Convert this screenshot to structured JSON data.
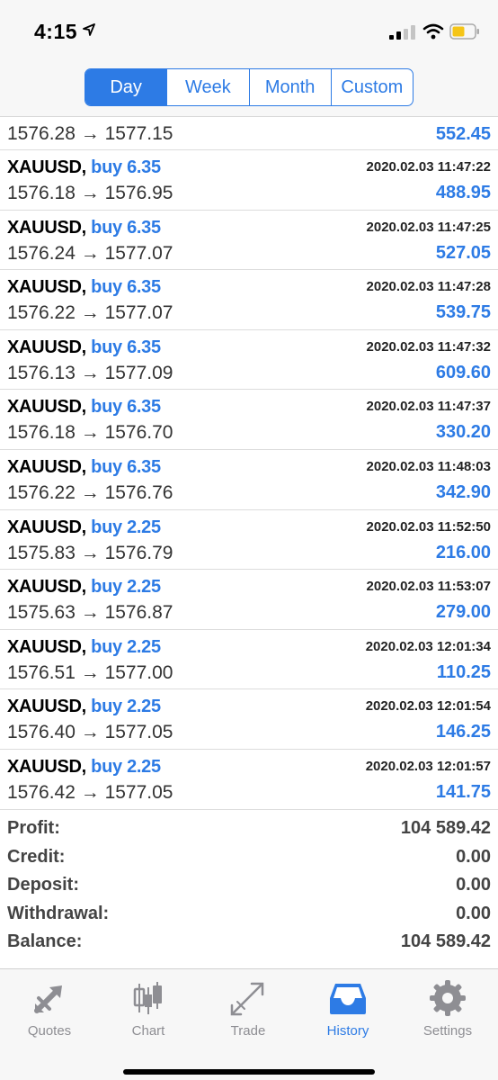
{
  "status": {
    "time": "4:15"
  },
  "periods": [
    {
      "label": "Day",
      "active": true
    },
    {
      "label": "Week",
      "active": false
    },
    {
      "label": "Month",
      "active": false
    },
    {
      "label": "Custom",
      "active": false
    }
  ],
  "partial_deal": {
    "prices": "1576.28 → 1577.15",
    "profit": "552.45"
  },
  "deals": [
    {
      "symbol": "XAUUSD",
      "side": "buy 6.35",
      "time": "2020.02.03 11:47:22",
      "prices": "1576.18 → 1576.95",
      "profit": "488.95"
    },
    {
      "symbol": "XAUUSD",
      "side": "buy 6.35",
      "time": "2020.02.03 11:47:25",
      "prices": "1576.24 → 1577.07",
      "profit": "527.05"
    },
    {
      "symbol": "XAUUSD",
      "side": "buy 6.35",
      "time": "2020.02.03 11:47:28",
      "prices": "1576.22 → 1577.07",
      "profit": "539.75"
    },
    {
      "symbol": "XAUUSD",
      "side": "buy 6.35",
      "time": "2020.02.03 11:47:32",
      "prices": "1576.13 → 1577.09",
      "profit": "609.60"
    },
    {
      "symbol": "XAUUSD",
      "side": "buy 6.35",
      "time": "2020.02.03 11:47:37",
      "prices": "1576.18 → 1576.70",
      "profit": "330.20"
    },
    {
      "symbol": "XAUUSD",
      "side": "buy 6.35",
      "time": "2020.02.03 11:48:03",
      "prices": "1576.22 → 1576.76",
      "profit": "342.90"
    },
    {
      "symbol": "XAUUSD",
      "side": "buy 2.25",
      "time": "2020.02.03 11:52:50",
      "prices": "1575.83 → 1576.79",
      "profit": "216.00"
    },
    {
      "symbol": "XAUUSD",
      "side": "buy 2.25",
      "time": "2020.02.03 11:53:07",
      "prices": "1575.63 → 1576.87",
      "profit": "279.00"
    },
    {
      "symbol": "XAUUSD",
      "side": "buy 2.25",
      "time": "2020.02.03 12:01:34",
      "prices": "1576.51 → 1577.00",
      "profit": "110.25"
    },
    {
      "symbol": "XAUUSD",
      "side": "buy 2.25",
      "time": "2020.02.03 12:01:54",
      "prices": "1576.40 → 1577.05",
      "profit": "146.25"
    },
    {
      "symbol": "XAUUSD",
      "side": "buy 2.25",
      "time": "2020.02.03 12:01:57",
      "prices": "1576.42 → 1577.05",
      "profit": "141.75"
    }
  ],
  "summary": [
    {
      "label": "Profit:",
      "value": "104 589.42"
    },
    {
      "label": "Credit:",
      "value": "0.00"
    },
    {
      "label": "Deposit:",
      "value": "0.00"
    },
    {
      "label": "Withdrawal:",
      "value": "0.00"
    },
    {
      "label": "Balance:",
      "value": "104 589.42"
    }
  ],
  "tabs": [
    {
      "label": "Quotes",
      "icon": "quotes-icon",
      "active": false
    },
    {
      "label": "Chart",
      "icon": "candlestick-icon",
      "active": false
    },
    {
      "label": "Trade",
      "icon": "trade-icon",
      "active": false
    },
    {
      "label": "History",
      "icon": "inbox-icon",
      "active": true
    },
    {
      "label": "Settings",
      "icon": "gear-icon",
      "active": false
    }
  ],
  "colors": {
    "accent": "#2d7be5",
    "inactive": "#8e8e93"
  }
}
